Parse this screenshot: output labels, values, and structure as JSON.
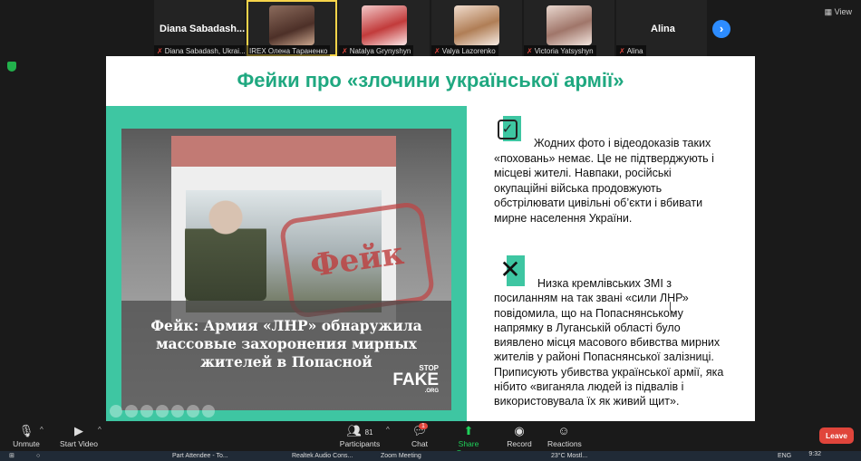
{
  "topbar": {
    "view_label": "View",
    "participants": [
      {
        "big_name": "Diana  Sabadash...",
        "caption": "Diana Sabadash, Ukrai...",
        "muted": true
      },
      {
        "big_name": "",
        "caption": "IREX Олена Тараненко",
        "muted": false
      },
      {
        "big_name": "",
        "caption": "Natalya Grynyshyn",
        "muted": true
      },
      {
        "big_name": "",
        "caption": "Valya Lazorenko",
        "muted": true
      },
      {
        "big_name": "",
        "caption": "Victoria Yatsyshyn",
        "muted": true
      },
      {
        "big_name": "Alina",
        "caption": "Alina",
        "muted": true
      }
    ],
    "next_icon": "chevron-right-icon"
  },
  "slide": {
    "title": "Фейки про «злочини української армії»",
    "photo": {
      "stamp": "Фейк",
      "caption": "Фейк: Армия «ЛНР» обнаружила массовые захоронения мирных жителей в Попасной",
      "stopfake_top": "STOP",
      "stopfake_main": "FAKE",
      "stopfake_sub": ".ORG"
    },
    "point1": "Жодних фото і відеодоказів таких «поховань» немає. Це не підтверджують і місцеві жителі. Навпаки, російські окупаційні війська продовжують обстрілювати цивільні об’єкти і вбивати мирне населення України.",
    "point2": "Низка кремлівських ЗМІ з посиланням на так звані «сили ЛНР» повідомила, що на Попаснянському напрямку в Луганській області було виявлено місця масового вбивства мирних жителів у районі Попаснянської залізниці. Приписують убивства української армії, яка нібито «виганяла людей із підвалів і використовувала їх як живий щит»."
  },
  "toolbar": {
    "unmute": "Unmute",
    "start_video": "Start Video",
    "participants_label": "Participants",
    "participants_count": "81",
    "chat": "Chat",
    "chat_badge": "1",
    "share_screen": "Share Screen",
    "record": "Record",
    "reactions": "Reactions",
    "leave": "Leave"
  },
  "taskbar": {
    "items": [
      "Part Attendee - To...",
      "Realtek Audio Cons...",
      "Zoom Meeting"
    ],
    "weather": "23°C  Mostl...",
    "lang": "ENG",
    "time": "9:32"
  },
  "colors": {
    "accent": "#3ec6a2",
    "title": "#1fa880",
    "leave": "#e0453b",
    "share": "#1fd15a"
  }
}
